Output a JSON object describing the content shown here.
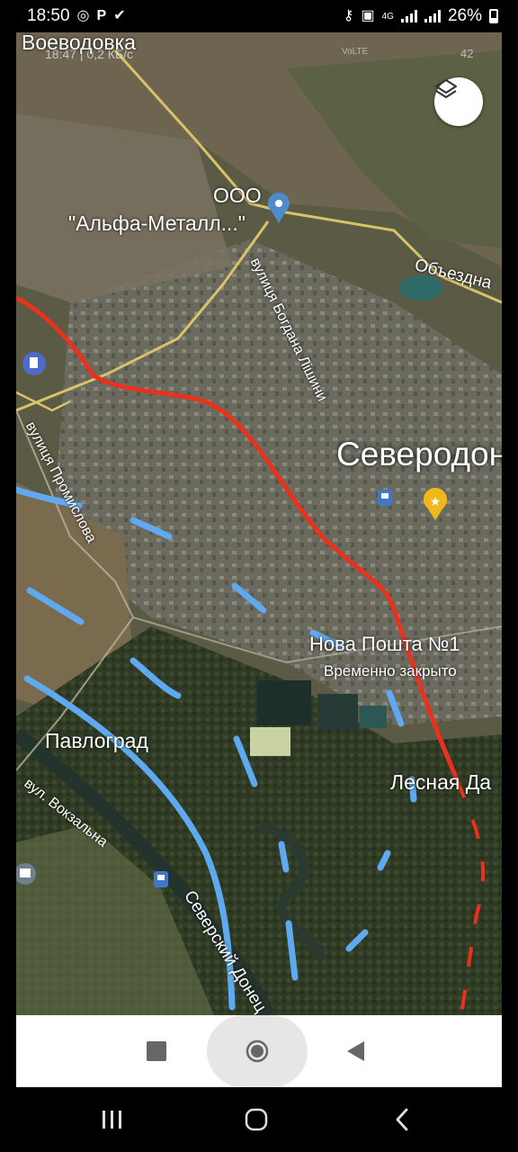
{
  "status_bar": {
    "time": "18:50",
    "battery": "26%",
    "network": "4G",
    "icons_left": [
      "whatsapp-icon",
      "parking-icon",
      "check-circle-icon"
    ],
    "icons_right": [
      "key-icon",
      "lock-icon",
      "signal-icon",
      "battery-icon"
    ]
  },
  "map": {
    "captured_status_text": "18:47 | 0,2 КБ/с",
    "captured_status_badge": "42",
    "captured_status_volte": "VoLTE",
    "place_labels": {
      "voevodovka": "Воеводовка",
      "company_top": "ООО",
      "company_bottom": "\"Альфа-Металл...\"",
      "objezdna": "Объездна",
      "bogdana_lishyny": "вулиця Богдана Лішини",
      "city": "Северодон",
      "promyslova": "вулиця Промислова",
      "nova_poshta": "Нова Пошта №1",
      "temporarily_closed": "Временно закрыто",
      "pavlograd": "Павлоград",
      "lesnaya": "Лесная Да",
      "vokzalna": "вул. Вокзальна",
      "seversky_donets": "Северский Донец"
    },
    "colors": {
      "red_route": "#e8321e",
      "blue_lines": "#5fa9f0",
      "roads": "#d9c36a",
      "pin_blue": "#4f8ac9",
      "pin_gold": "#f2b81b"
    }
  },
  "bottom_bar": {
    "buttons": [
      "stop-button",
      "record-button",
      "back-button"
    ]
  },
  "system_nav": {
    "buttons": [
      "recent-apps-button",
      "home-button",
      "back-nav-button"
    ]
  }
}
